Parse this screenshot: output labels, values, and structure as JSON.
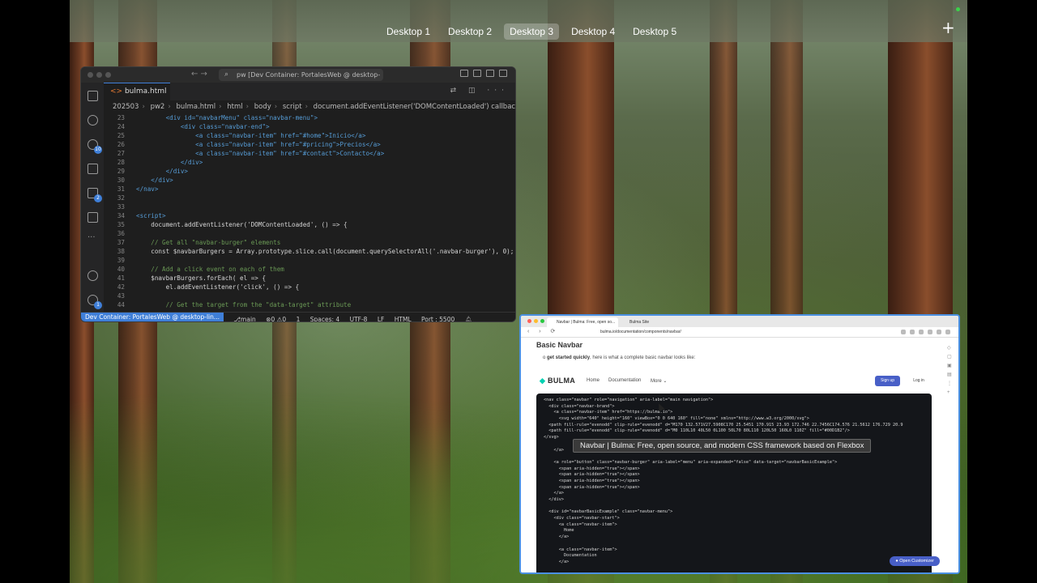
{
  "desktop": {
    "tabs": [
      "Desktop 1",
      "Desktop 2",
      "Desktop 3",
      "Desktop 4",
      "Desktop 5"
    ],
    "active_tab": "Desktop 3",
    "add_icon": "plus-icon"
  },
  "vscode": {
    "title": "pw [Dev Container: PortalesWeb @ desktop-linux]",
    "tab": {
      "filename": "bulma.html",
      "status": "U"
    },
    "breadcrumb": [
      "202503",
      "pw2",
      "bulma.html",
      "html",
      "body",
      "script",
      "document.addEventListener('DOMContentLoaded') callback"
    ],
    "activity_badges": {
      "source_control": "10",
      "extensions": "2",
      "manage": "1"
    },
    "code_lines": [
      {
        "n": "23",
        "text": "        <div id=\"navbarMenu\" class=\"navbar-menu\">"
      },
      {
        "n": "24",
        "text": "            <div class=\"navbar-end\">"
      },
      {
        "n": "25",
        "text": "                <a class=\"navbar-item\" href=\"#home\">Inicio</a>"
      },
      {
        "n": "26",
        "text": "                <a class=\"navbar-item\" href=\"#pricing\">Precios</a>"
      },
      {
        "n": "27",
        "text": "                <a class=\"navbar-item\" href=\"#contact\">Contacto</a>"
      },
      {
        "n": "28",
        "text": "            </div>"
      },
      {
        "n": "29",
        "text": "        </div>"
      },
      {
        "n": "30",
        "text": "    </div>"
      },
      {
        "n": "31",
        "text": "</nav>"
      },
      {
        "n": "32",
        "text": ""
      },
      {
        "n": "33",
        "text": ""
      },
      {
        "n": "34",
        "text": "<script>"
      },
      {
        "n": "35",
        "text": "    document.addEventListener('DOMContentLoaded', () => {"
      },
      {
        "n": "36",
        "text": ""
      },
      {
        "n": "37",
        "text": "    // Get all \"navbar-burger\" elements"
      },
      {
        "n": "38",
        "text": "    const $navbarBurgers = Array.prototype.slice.call(document.querySelectorAll('.navbar-burger'), 0);"
      },
      {
        "n": "39",
        "text": ""
      },
      {
        "n": "40",
        "text": "    // Add a click event on each of them"
      },
      {
        "n": "41",
        "text": "    $navbarBurgers.forEach( el => {"
      },
      {
        "n": "42",
        "text": "        el.addEventListener('click', () => {"
      },
      {
        "n": "43",
        "text": ""
      },
      {
        "n": "44",
        "text": "        // Get the target from the \"data-target\" attribute"
      }
    ],
    "status": {
      "remote": "Dev Container: PortalesWeb @ desktop-lin...",
      "branch": "main",
      "errors": "0",
      "warnings": "0",
      "info": "1",
      "spaces": "Spaces: 4",
      "encoding": "UTF-8",
      "eol": "LF",
      "language": "HTML",
      "port": "Port : 5500"
    }
  },
  "browser": {
    "tabs": [
      "Navbar | Bulma: Free, open so...",
      "Bulma Site"
    ],
    "url": "bulma.io/documentation/components/navbar/",
    "page": {
      "heading": "Basic Navbar",
      "intro_bold": "get started quickly",
      "intro_rest": ", here is what a complete basic navbar looks like:",
      "intro_prefix": "o",
      "logo": "BULMA",
      "links": [
        "Home",
        "Documentation",
        "More"
      ],
      "signup": "Sign up",
      "login": "Log in",
      "code_lines": [
        "<nav class=\"navbar\" role=\"navigation\" aria-label=\"main navigation\">",
        "  <div class=\"navbar-brand\">",
        "    <a class=\"navbar-item\" href=\"https://bulma.io\">",
        "      <svg width=\"640\" height=\"160\" viewBox=\"0 0 640 160\" fill=\"none\" xmlns=\"http://www.w3.org/2000/svg\">",
        "  <path fill-rule=\"evenodd\" clip-rule=\"evenodd\" d=\"M170 132.571V27.5908C170 25.5451 170.915 23.93 172.746 22.7456C174.576 21.5612 176.729 20.9",
        "  <path fill-rule=\"evenodd\" clip-rule=\"evenodd\" d=\"M0 110L10 40L50 0L100 50L70 80L110 120L50 160L0 110Z\" fill=\"#00D1B2\"/>",
        "</svg>",
        "",
        "    </a>",
        "",
        "    <a role=\"button\" class=\"navbar-burger\" aria-label=\"menu\" aria-expanded=\"false\" data-target=\"navbarBasicExample\">",
        "      <span aria-hidden=\"true\"></span>",
        "      <span aria-hidden=\"true\"></span>",
        "      <span aria-hidden=\"true\"></span>",
        "      <span aria-hidden=\"true\"></span>",
        "    </a>",
        "  </div>",
        "",
        "  <div id=\"navbarBasicExample\" class=\"navbar-menu\">",
        "    <div class=\"navbar-start\">",
        "      <a class=\"navbar-item\">",
        "        Home",
        "      </a>",
        "",
        "      <a class=\"navbar-item\">",
        "        Documentation",
        "      </a>"
      ],
      "tooltip": "Navbar | Bulma: Free, open source, and modern CSS framework based on Flexbox",
      "customizer": "Open Customizer"
    }
  },
  "colors": {
    "bulma_primary": "#485fc7",
    "bulma_turquoise": "#00d1b2",
    "vscode_accent": "#3f7fd8"
  }
}
